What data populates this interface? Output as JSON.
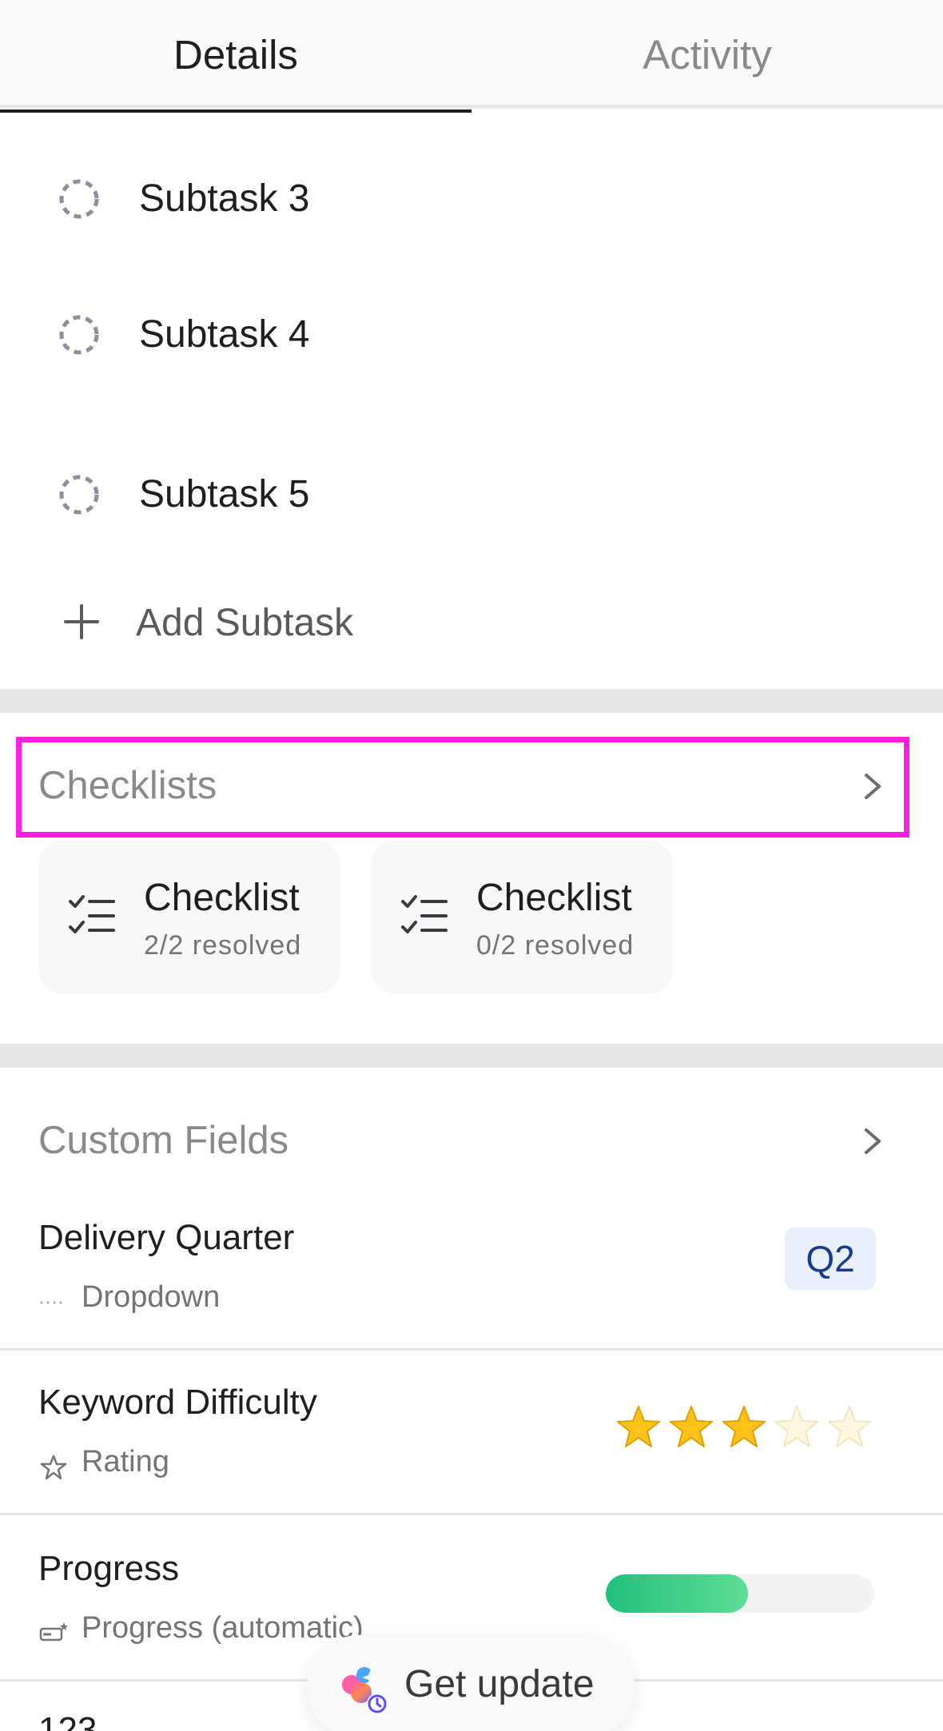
{
  "tabs": [
    {
      "label": "Details",
      "active": true
    },
    {
      "label": "Activity",
      "active": false
    }
  ],
  "subtasks": {
    "items": [
      {
        "label": "Subtask 3",
        "status_icon": "dashed-circle-icon"
      },
      {
        "label": "Subtask 4",
        "status_icon": "dashed-circle-icon"
      },
      {
        "label": "Subtask 5",
        "status_icon": "dashed-circle-icon"
      }
    ],
    "add_label": "Add Subtask"
  },
  "checklists": {
    "title": "Checklists",
    "cards": [
      {
        "name": "Checklist",
        "status": "2/2 resolved",
        "icon": "checklist-icon"
      },
      {
        "name": "Checklist",
        "status": "0/2 resolved",
        "icon": "checklist-icon"
      }
    ]
  },
  "custom_fields": {
    "title": "Custom Fields",
    "fields": [
      {
        "name": "Delivery Quarter",
        "type": "Dropdown",
        "type_icon": "dropdown-dots-icon",
        "value": "Q2"
      },
      {
        "name": "Keyword Difficulty",
        "type": "Rating",
        "type_icon": "star-outline-icon",
        "rating": 3,
        "rating_max": 5
      },
      {
        "name": "Progress",
        "type": "Progress (automatic)",
        "type_icon": "progress-auto-icon",
        "progress_percent": 53
      }
    ],
    "next_field_peek": "123"
  },
  "floating_action": {
    "label": "Get update",
    "icon": "ai-sparkle-icon"
  },
  "colors": {
    "highlight": "#ff1fe0",
    "progress_fill": "#22c07d",
    "badge_bg": "#e9effb",
    "badge_text": "#1a3a8f",
    "star_filled": "#ffc21a"
  }
}
